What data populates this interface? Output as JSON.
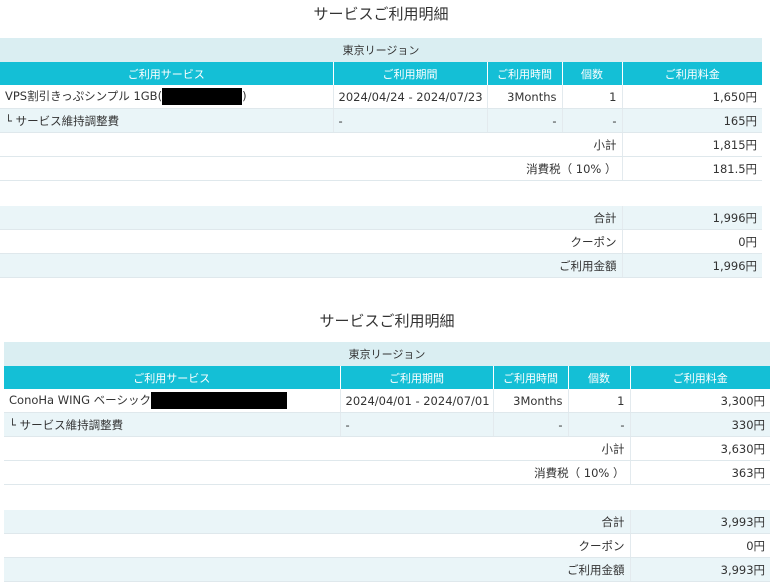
{
  "statements": [
    {
      "title": "サービスご利用明細",
      "region": "東京リージョン",
      "headers": {
        "service": "ご利用サービス",
        "period": "ご利用期間",
        "duration": "ご利用時間",
        "qty": "個数",
        "fee": "ご利用料金"
      },
      "rows": [
        {
          "service": "VPS割引きっぷシンプル 1GB(",
          "service_suffix": ")",
          "period": "2024/04/24 - 2024/07/23",
          "duration": "3Months",
          "qty": "1",
          "fee": "1,650円"
        },
        {
          "service": "└ サービス維持調整費",
          "service_suffix": "",
          "period": "-",
          "duration": "-",
          "qty": "-",
          "fee": "165円"
        }
      ],
      "subtotal": {
        "label": "小計",
        "value": "1,815円"
      },
      "tax": {
        "label": "消費税（ 10% ）",
        "value": "181.5円"
      },
      "total": {
        "label": "合計",
        "value": "1,996円"
      },
      "coupon": {
        "label": "クーポン",
        "value": "0円"
      },
      "amount": {
        "label": "ご利用金額",
        "value": "1,996円"
      }
    },
    {
      "title": "サービスご利用明細",
      "region": "東京リージョン",
      "headers": {
        "service": "ご利用サービス",
        "period": "ご利用期間",
        "duration": "ご利用時間",
        "qty": "個数",
        "fee": "ご利用料金"
      },
      "rows": [
        {
          "service": "ConoHa WING ベーシック",
          "service_suffix": "",
          "period": "2024/04/01 - 2024/07/01",
          "duration": "3Months",
          "qty": "1",
          "fee": "3,300円"
        },
        {
          "service": "└ サービス維持調整費",
          "service_suffix": "",
          "period": "-",
          "duration": "-",
          "qty": "-",
          "fee": "330円"
        }
      ],
      "subtotal": {
        "label": "小計",
        "value": "3,630円"
      },
      "tax": {
        "label": "消費税（ 10% ）",
        "value": "363円"
      },
      "total": {
        "label": "合計",
        "value": "3,993円"
      },
      "coupon": {
        "label": "クーポン",
        "value": "0円"
      },
      "amount": {
        "label": "ご利用金額",
        "value": "3,993円"
      }
    }
  ]
}
